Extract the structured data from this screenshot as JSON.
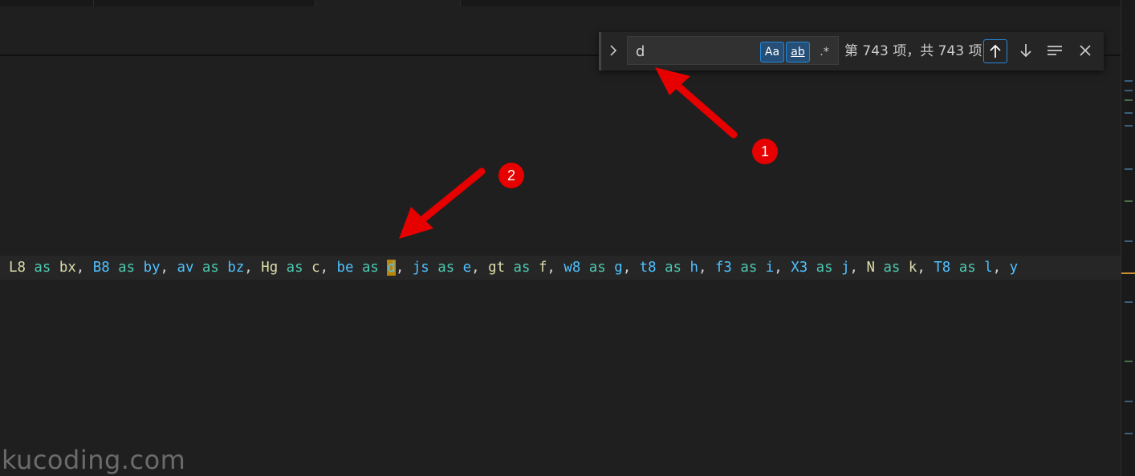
{
  "find": {
    "query": "d",
    "match_case_label": "Aa",
    "whole_word_label": "ab",
    "regex_label": ".*",
    "match_count": "第 743 项，共 743 项",
    "expand_icon": "chevron-right-icon",
    "prev_icon": "arrow-up-icon",
    "next_icon": "arrow-down-icon",
    "selection_icon": "find-in-selection-icon",
    "close_icon": "close-icon"
  },
  "code": {
    "tokens": [
      {
        "t": "L8",
        "c": "fn"
      },
      {
        "t": " as ",
        "c": "kw"
      },
      {
        "t": "bx",
        "c": "fn"
      },
      {
        "t": ", ",
        "c": "plain"
      },
      {
        "t": "B8",
        "c": "id"
      },
      {
        "t": " as ",
        "c": "kw"
      },
      {
        "t": "by",
        "c": "id"
      },
      {
        "t": ", ",
        "c": "plain"
      },
      {
        "t": "av",
        "c": "id"
      },
      {
        "t": " as ",
        "c": "kw"
      },
      {
        "t": "bz",
        "c": "id"
      },
      {
        "t": ", ",
        "c": "plain"
      },
      {
        "t": "Hg",
        "c": "fn"
      },
      {
        "t": " as ",
        "c": "kw"
      },
      {
        "t": "c",
        "c": "fn"
      },
      {
        "t": ", ",
        "c": "plain"
      },
      {
        "t": "be",
        "c": "id"
      },
      {
        "t": " as ",
        "c": "kw"
      },
      {
        "t": "d",
        "c": "match"
      },
      {
        "t": ", ",
        "c": "plain"
      },
      {
        "t": "js",
        "c": "id"
      },
      {
        "t": " as ",
        "c": "kw"
      },
      {
        "t": "e",
        "c": "id"
      },
      {
        "t": ", ",
        "c": "plain"
      },
      {
        "t": "gt",
        "c": "fn"
      },
      {
        "t": " as ",
        "c": "kw"
      },
      {
        "t": "f",
        "c": "fn"
      },
      {
        "t": ", ",
        "c": "plain"
      },
      {
        "t": "w8",
        "c": "id"
      },
      {
        "t": " as ",
        "c": "kw"
      },
      {
        "t": "g",
        "c": "id"
      },
      {
        "t": ", ",
        "c": "plain"
      },
      {
        "t": "t8",
        "c": "id"
      },
      {
        "t": " as ",
        "c": "kw"
      },
      {
        "t": "h",
        "c": "id"
      },
      {
        "t": ", ",
        "c": "plain"
      },
      {
        "t": "f3",
        "c": "id"
      },
      {
        "t": " as ",
        "c": "kw"
      },
      {
        "t": "i",
        "c": "id"
      },
      {
        "t": ", ",
        "c": "plain"
      },
      {
        "t": "X3",
        "c": "id"
      },
      {
        "t": " as ",
        "c": "kw"
      },
      {
        "t": "j",
        "c": "id"
      },
      {
        "t": ", ",
        "c": "plain"
      },
      {
        "t": "N",
        "c": "fn"
      },
      {
        "t": " as ",
        "c": "kw"
      },
      {
        "t": "k",
        "c": "fn"
      },
      {
        "t": ", ",
        "c": "plain"
      },
      {
        "t": "T8",
        "c": "id"
      },
      {
        "t": " as ",
        "c": "kw"
      },
      {
        "t": "l",
        "c": "id"
      },
      {
        "t": ", ",
        "c": "plain"
      },
      {
        "t": "y",
        "c": "id"
      }
    ]
  },
  "annotations": {
    "badge_1": "1",
    "badge_2": "2"
  },
  "watermark": "kucoding.com",
  "colors": {
    "annotation_red": "#e60000",
    "match_highlight": "#b8860b",
    "focus_border": "#2488db"
  }
}
